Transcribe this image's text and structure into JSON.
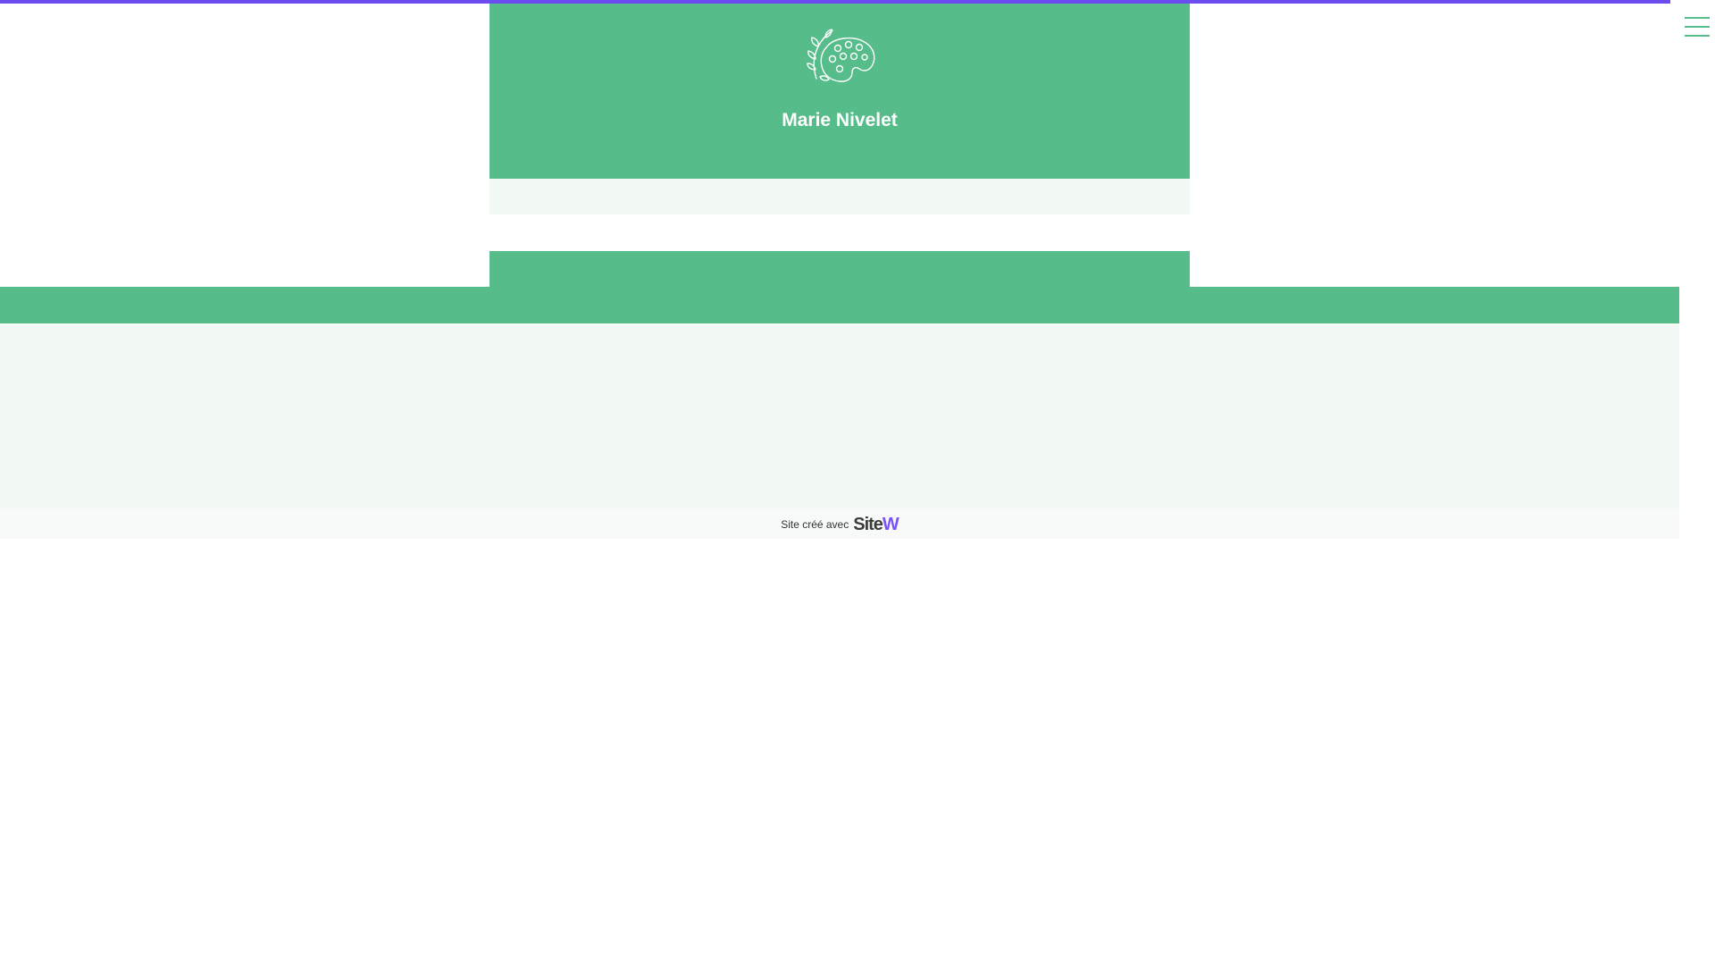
{
  "site": {
    "title": "Marie Nivelet"
  },
  "footer": {
    "text": "Site créé avec",
    "brand_main": "Site",
    "brand_accent": "W"
  },
  "icons": {
    "logo": "palette-with-branch-icon",
    "menu": "hamburger-menu-icon"
  },
  "colors": {
    "primary_green": "#55bc8a",
    "light_background": "#f3f9f4",
    "progress_accent": "#6b4cf0",
    "brand_purple": "#7b52f5"
  }
}
